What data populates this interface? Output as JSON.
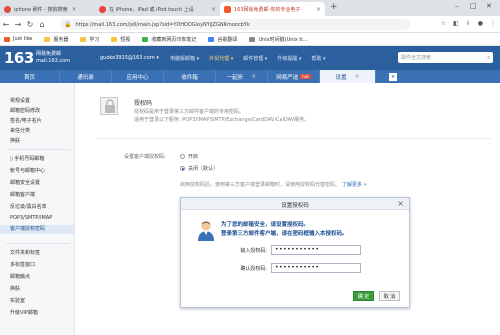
{
  "browser": {
    "tabs": [
      {
        "label": "iphone 刷件 - 搜狗搜索"
      },
      {
        "label": "在 iPhone、iPad 或 iPod touch 上设"
      },
      {
        "label": "163网易免费邮-你的专业电子"
      }
    ],
    "url_scheme": "https",
    "url": "https://mail.163.com/js6/main.jsp?sid=YDHDOGloyNYiJZGNKmoocbYk",
    "bookmarks": [
      "Just like",
      "服务器",
      "学习",
      "短视",
      "收藏到网页印象笔记",
      "谷歌翻译",
      "Unix时间戳(Unix ti..."
    ]
  },
  "mail": {
    "logo": "163",
    "logo_sub1": "网易免费邮",
    "logo_sub2": "mail.163.com",
    "account": "guoke3915@163.com ▾",
    "top_links": [
      "电脑版邮箱 ▾",
      "外贸代理 ▾",
      "邮件管理 ▾",
      "升级提醒 ▾",
      "帮助 ▾"
    ],
    "search_placeholder": "邮件全文搜索",
    "nav": [
      {
        "label": "首页"
      },
      {
        "label": "通讯录"
      },
      {
        "label": "应用中心"
      },
      {
        "label": "收件箱"
      },
      {
        "label": "一起折",
        "badge": ""
      },
      {
        "label": "网易严选",
        "badge": "hot"
      },
      {
        "label": "设置"
      }
    ]
  },
  "sidebar": {
    "items": [
      "常规设置",
      "邮箱密码修改",
      "签名/电子名片",
      "来信分类",
      "换肤",
      "手机号码邮箱",
      "帐号与邮箱中心",
      "邮箱安全设置",
      "邮箱客户端",
      "反垃圾/黑白名单",
      "POP3/SMTP/IMAP",
      "客户端授权密码",
      "文件夹和标签",
      "多标签窗口",
      "邮箱触点",
      "换肤",
      "实验室",
      "升级VIP邮箱"
    ]
  },
  "content": {
    "title": "授权码",
    "desc1": "授权码是用于登录第三方邮件客户端的专用密码。",
    "desc2": "适用于登录以下服务: POP3/IMAP/SMTP/Exchange/CardDAV/CalDAV服务。",
    "label": "设置客户端授权码:",
    "radio_on": "开启",
    "radio_off": "关闭（默认）",
    "hint": "启用授权码后，使用第三方客户端登录邮箱时，请使用授权码代替密码。",
    "more": "了解更多 »"
  },
  "modal": {
    "title": "设置授权码",
    "line1": "为了您的邮箱安全，请设置授权码。",
    "line2": "登录第三方邮件客户端，请在密码框输入本授权码。",
    "field1_label": "输入授权码:",
    "field1_value": "•••••••••••",
    "field2_label": "确认授权码:",
    "field2_value": "•••••••••••",
    "ok": "确 定",
    "cancel": "取 消"
  }
}
